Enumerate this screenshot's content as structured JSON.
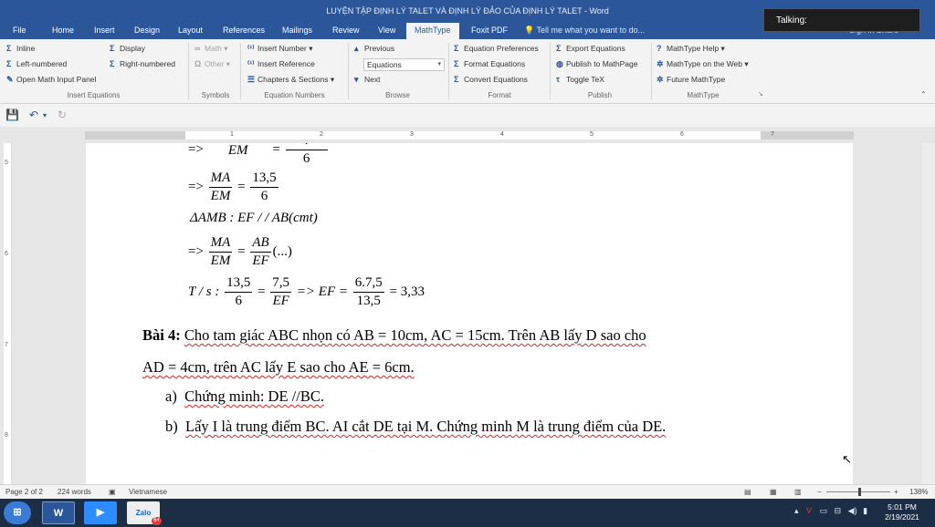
{
  "window": {
    "title": "LUYỆN TẬP ĐỊNH LÝ TALET VÀ ĐỊNH LÝ ĐẢO CỦA ĐỊNH LÝ TALET - Word"
  },
  "talking": "Talking:",
  "tabs": [
    "File",
    "Home",
    "Insert",
    "Design",
    "Layout",
    "References",
    "Mailings",
    "Review",
    "View",
    "MathType",
    "Foxit PDF"
  ],
  "active_tab": "MathType",
  "tell_me": "Tell me what you want to do...",
  "sign_in": "Sign in   Share",
  "ribbon": {
    "insert_equations": {
      "label": "Insert Equations",
      "inline": "Inline",
      "display": "Display",
      "left_numbered": "Left-numbered",
      "right_numbered": "Right-numbered",
      "open_math_input": "Open Math Input Panel"
    },
    "symbols": {
      "label": "Symbols",
      "math": "Math",
      "other": "Other"
    },
    "equation_numbers": {
      "label": "Equation Numbers",
      "insert_number": "Insert Number",
      "insert_reference": "Insert Reference",
      "chapters_sections": "Chapters & Sections"
    },
    "browse": {
      "label": "Browse",
      "previous": "Previous",
      "select_value": "Equations",
      "next": "Next"
    },
    "format": {
      "label": "Format",
      "equation_preferences": "Equation Preferences",
      "format_equations": "Format Equations",
      "convert_equations": "Convert Equations"
    },
    "publish": {
      "label": "Publish",
      "export_equations": "Export Equations",
      "publish_mathpage": "Publish to MathPage",
      "toggle_tex": "Toggle TeX"
    },
    "mathtype": {
      "label": "MathType",
      "help": "MathType Help",
      "on_web": "MathType on the Web",
      "future": "Future MathType"
    }
  },
  "ruler": {
    "top": [
      "1",
      "2",
      "3",
      "4",
      "5",
      "6",
      "7"
    ],
    "left": [
      "5",
      "6",
      "7",
      "8"
    ]
  },
  "document": {
    "eq1": {
      "arrow": "=>",
      "num": "",
      "den": "EM",
      "eq": "=",
      "num2": ".",
      "den2": "6"
    },
    "eq2": {
      "arrow": "=>",
      "num": "MA",
      "den": "EM",
      "eq": "=",
      "num2": "13,5",
      "den2": "6"
    },
    "eq3": {
      "text": "ΔAMB : EF / / AB(cmt)"
    },
    "eq4": {
      "arrow": "=>",
      "num": "MA",
      "den": "EM",
      "eq": "=",
      "num2": "AB",
      "den2": "EF",
      "tail": "(...)"
    },
    "eq5": {
      "prefix": "T / s :",
      "n1": "13,5",
      "d1": "6",
      "eq1": "=",
      "n2": "7,5",
      "d2": "EF",
      "mid": "=> EF =",
      "n3": "6.7,5",
      "d3": "13,5",
      "result": "= 3,33"
    },
    "problem": {
      "label": "Bài 4:",
      "line1": "Cho tam giác ABC nhọn có AB = 10cm, AC = 15cm. Trên AB lấy D sao cho",
      "line2": "AD = 4cm, trên AC lấy E sao cho AE = 6cm.",
      "item_a_marker": "a)",
      "item_a": "Chứng minh: DE //BC.",
      "item_b_marker": "b)",
      "item_b": "Lấy I là trung điểm BC. AI cắt DE tại M. Chứng minh M là trung điểm của DE."
    }
  },
  "status": {
    "page": "Page 2 of 2",
    "words": "224 words",
    "language": "Vietnamese",
    "zoom": "138%"
  },
  "taskbar": {
    "word_label": "W",
    "zoom_label": "Zoom",
    "zalo_label": "Zalo",
    "zalo_badge": "5+",
    "time": "5:01 PM",
    "date": "2/19/2021"
  }
}
